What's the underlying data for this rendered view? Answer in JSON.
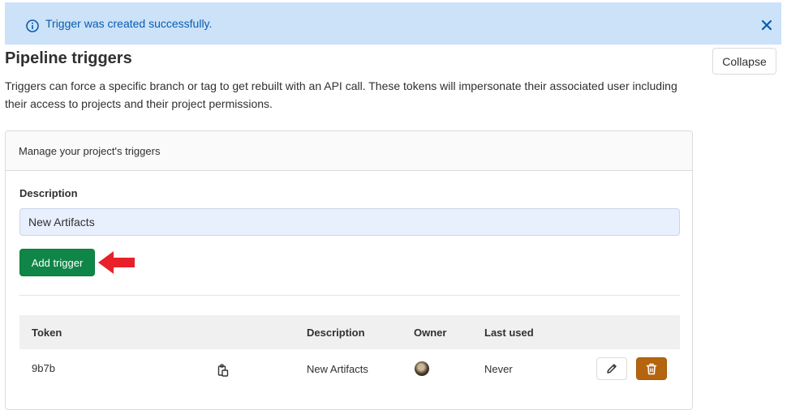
{
  "flash": {
    "message": "Trigger was created successfully.",
    "info_icon": "info-icon",
    "close_icon": "close-icon"
  },
  "section": {
    "title": "Pipeline triggers",
    "collapse_label": "Collapse",
    "description": "Triggers can force a specific branch or tag to get rebuilt with an API call. These tokens will impersonate their associated user including their access to projects and their project permissions."
  },
  "card": {
    "header": "Manage your project's triggers",
    "form": {
      "description_label": "Description",
      "description_value": "New Artifacts",
      "add_button": "Add trigger"
    },
    "table": {
      "columns": [
        "Token",
        "Description",
        "Owner",
        "Last used"
      ],
      "rows": [
        {
          "token": "9b7b",
          "description": "New Artifacts",
          "owner": "avatar",
          "last_used": "Never"
        }
      ]
    }
  },
  "colors": {
    "flash_bg": "#cbe2f9",
    "flash_text": "#0b5cad",
    "primary_button": "#108548",
    "delete_button": "#b5650f",
    "annotation_arrow": "#e8202a"
  }
}
